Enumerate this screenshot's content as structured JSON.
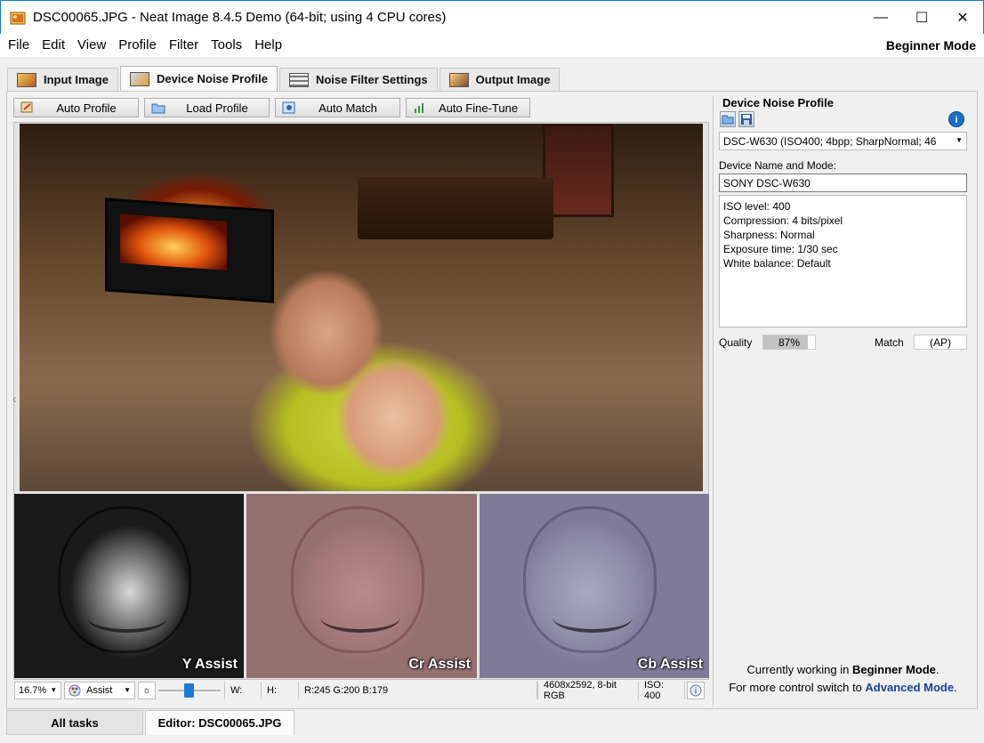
{
  "window": {
    "title": "DSC00065.JPG - Neat Image 8.4.5 Demo (64-bit; using 4 CPU cores)",
    "minimize": "—",
    "maximize": "☐",
    "close": "✕"
  },
  "menu": {
    "items": [
      "File",
      "Edit",
      "View",
      "Profile",
      "Filter",
      "Tools",
      "Help"
    ],
    "mode": "Beginner Mode"
  },
  "tabs": [
    {
      "label": "Input Image",
      "icon": "input-image-icon",
      "active": false
    },
    {
      "label": "Device Noise Profile",
      "icon": "device-profile-icon",
      "active": true
    },
    {
      "label": "Noise Filter Settings",
      "icon": "filter-settings-icon",
      "active": false
    },
    {
      "label": "Output Image",
      "icon": "output-image-icon",
      "active": false
    }
  ],
  "toolbar": {
    "auto_profile": "Auto Profile",
    "load_profile": "Load Profile",
    "auto_match": "Auto Match",
    "auto_fine_tune": "Auto Fine-Tune"
  },
  "viewer": {
    "sub_labels": [
      "Y Assist",
      "Cr Assist",
      "Cb Assist"
    ]
  },
  "status": {
    "zoom": "16.7%",
    "view_mode": "Assist",
    "w_label": "W:",
    "h_label": "H:",
    "rgb": "R:245 G:200 B:179",
    "image_info": "4608x2592, 8-bit RGB",
    "iso": "ISO: 400"
  },
  "panel": {
    "header": "Device Noise Profile",
    "profile_select": "DSC-W630 (ISO400; 4bpp; SharpNormal; 46",
    "name_label": "Device Name and Mode:",
    "name_value": "SONY DSC-W630",
    "details": [
      "ISO level: 400",
      "Compression: 4 bits/pixel",
      "Sharpness: Normal",
      "Exposure time: 1/30 sec",
      "White balance: Default"
    ],
    "quality_label": "Quality",
    "quality_value": "87%",
    "quality_fraction": 0.87,
    "match_label": "Match",
    "match_value": "(AP)",
    "footer_line1_pre": "Currently working in ",
    "footer_line1_mode": "Beginner Mode",
    "footer_line1_post": ".",
    "footer_line2_pre": "For more control switch to ",
    "footer_line2_link": "Advanced Mode",
    "footer_line2_post": "."
  },
  "bottom_tabs": {
    "all_tasks": "All tasks",
    "editor": "Editor: DSC00065.JPG"
  },
  "colors": {
    "accent": "#1a6fc9",
    "link": "#1a3f9c",
    "slider": "#1e7ad6"
  }
}
